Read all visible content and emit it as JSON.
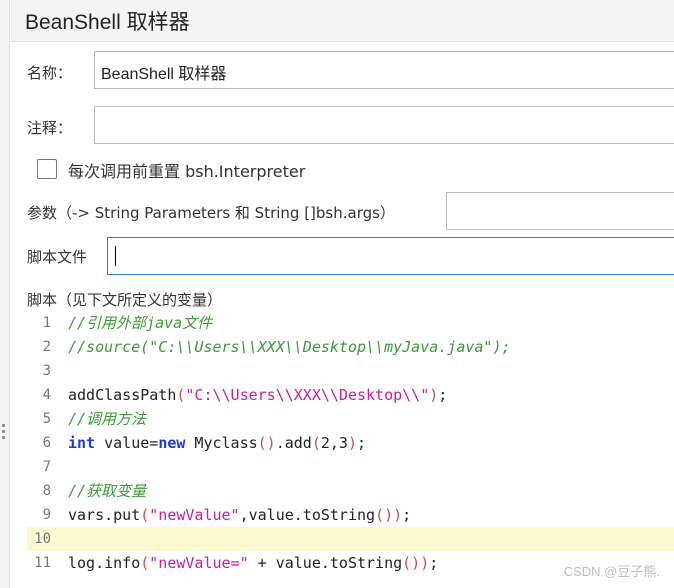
{
  "title": "BeanShell 取样器",
  "fields": {
    "name_label": "名称：",
    "name_value": "BeanShell 取样器",
    "comment_label": "注释：",
    "comment_value": "",
    "reset_checkbox_label": "每次调用前重置 bsh.Interpreter",
    "reset_checked": false,
    "params_label": "参数（-> String Parameters 和 String []bsh.args）",
    "params_value": "",
    "script_file_label": "脚本文件",
    "script_file_value": "",
    "script_label": "脚本（见下文所定义的变量）"
  },
  "editor": {
    "current_line": 10,
    "lines": [
      {
        "number": "1",
        "tokens": [
          {
            "t": "//引用外部java文件",
            "k": "comment"
          }
        ]
      },
      {
        "number": "2",
        "tokens": [
          {
            "t": "//source(\"C:\\\\Users\\\\XXX\\\\Desktop\\\\myJava.java\");",
            "k": "comment"
          }
        ]
      },
      {
        "number": "3",
        "tokens": []
      },
      {
        "number": "4",
        "tokens": [
          {
            "t": "addClassPath",
            "k": "plain"
          },
          {
            "t": "(",
            "k": "paren"
          },
          {
            "t": "\"C:\\\\Users\\\\XXX\\\\Desktop\\\\\"",
            "k": "string"
          },
          {
            "t": ")",
            "k": "paren"
          },
          {
            "t": ";",
            "k": "plain"
          }
        ]
      },
      {
        "number": "5",
        "tokens": [
          {
            "t": "//调用方法",
            "k": "comment"
          }
        ]
      },
      {
        "number": "6",
        "tokens": [
          {
            "t": "int",
            "k": "keyword"
          },
          {
            "t": " value=",
            "k": "plain"
          },
          {
            "t": "new",
            "k": "keyword"
          },
          {
            "t": " Myclass",
            "k": "plain"
          },
          {
            "t": "()",
            "k": "paren"
          },
          {
            "t": ".add",
            "k": "plain"
          },
          {
            "t": "(",
            "k": "paren"
          },
          {
            "t": "2,3",
            "k": "plain"
          },
          {
            "t": ")",
            "k": "paren"
          },
          {
            "t": ";",
            "k": "plain"
          }
        ]
      },
      {
        "number": "7",
        "tokens": []
      },
      {
        "number": "8",
        "tokens": [
          {
            "t": "//获取变量",
            "k": "comment"
          }
        ]
      },
      {
        "number": "9",
        "tokens": [
          {
            "t": "vars.put",
            "k": "plain"
          },
          {
            "t": "(",
            "k": "paren"
          },
          {
            "t": "\"newValue\"",
            "k": "string"
          },
          {
            "t": ",value.toString",
            "k": "plain"
          },
          {
            "t": "())",
            "k": "paren"
          },
          {
            "t": ";",
            "k": "plain"
          }
        ]
      },
      {
        "number": "10",
        "tokens": []
      },
      {
        "number": "11",
        "tokens": [
          {
            "t": "log.info",
            "k": "plain"
          },
          {
            "t": "(",
            "k": "paren"
          },
          {
            "t": "\"newValue=\"",
            "k": "string"
          },
          {
            "t": " + value.toString",
            "k": "plain"
          },
          {
            "t": "())",
            "k": "paren"
          },
          {
            "t": ";",
            "k": "plain"
          }
        ]
      }
    ]
  },
  "watermark": "CSDN @豆子熊."
}
